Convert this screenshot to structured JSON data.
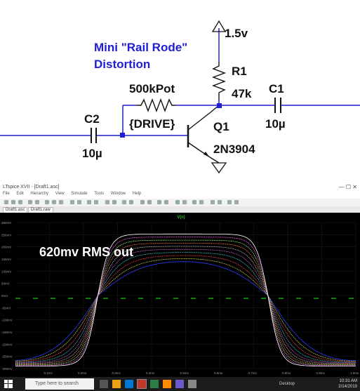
{
  "schematic": {
    "title_line1": "Mini \"Rail Rode\"",
    "title_line2": "Distortion",
    "supply": "1.5v",
    "r1_name": "R1",
    "r1_value": "47k",
    "c1_name": "C1",
    "c1_value": "10µ",
    "pot_name": "500kPot",
    "pot_param": "{DRIVE}",
    "q1_name": "Q1",
    "q1_model": "2N3904",
    "c2_name": "C2",
    "c2_value": "10µ"
  },
  "plot": {
    "trace_label": "V(n)",
    "annotation": "620mv RMS out",
    "y_ticks": [
      "300mV",
      "250mV",
      "200mV",
      "150mV",
      "100mV",
      "50mV",
      "0mV",
      "-50mV",
      "-100mV",
      "-150mV",
      "-200mV",
      "-250mV",
      "-300mV"
    ],
    "x_ticks": [
      "0.1ms",
      "0.2ms",
      "0.3ms",
      "0.4ms",
      "0.5ms",
      "0.6ms",
      "0.7ms",
      "0.8ms",
      "0.9ms",
      "1.0ms"
    ],
    "trace_colors": [
      "#2a3cff",
      "#d8d840",
      "#ff4040",
      "#40d0d0",
      "#d060d0",
      "#c0c0c0",
      "#ff8040",
      "#a0ff80",
      "#ff60ff",
      "#ffffff"
    ]
  },
  "ltspice": {
    "title": "LTspice XVII - [Draft1.asc]",
    "menu": [
      "File",
      "Edit",
      "Hierarchy",
      "View",
      "Simulate",
      "Tools",
      "Window",
      "Help"
    ],
    "tabs": [
      "Draft1.asc",
      "Draft1.raw"
    ]
  },
  "taskbar": {
    "search_placeholder": "Type here to search",
    "tray_text": "Desktop",
    "time": "10:31 AM",
    "date": "2/14/2019"
  }
}
